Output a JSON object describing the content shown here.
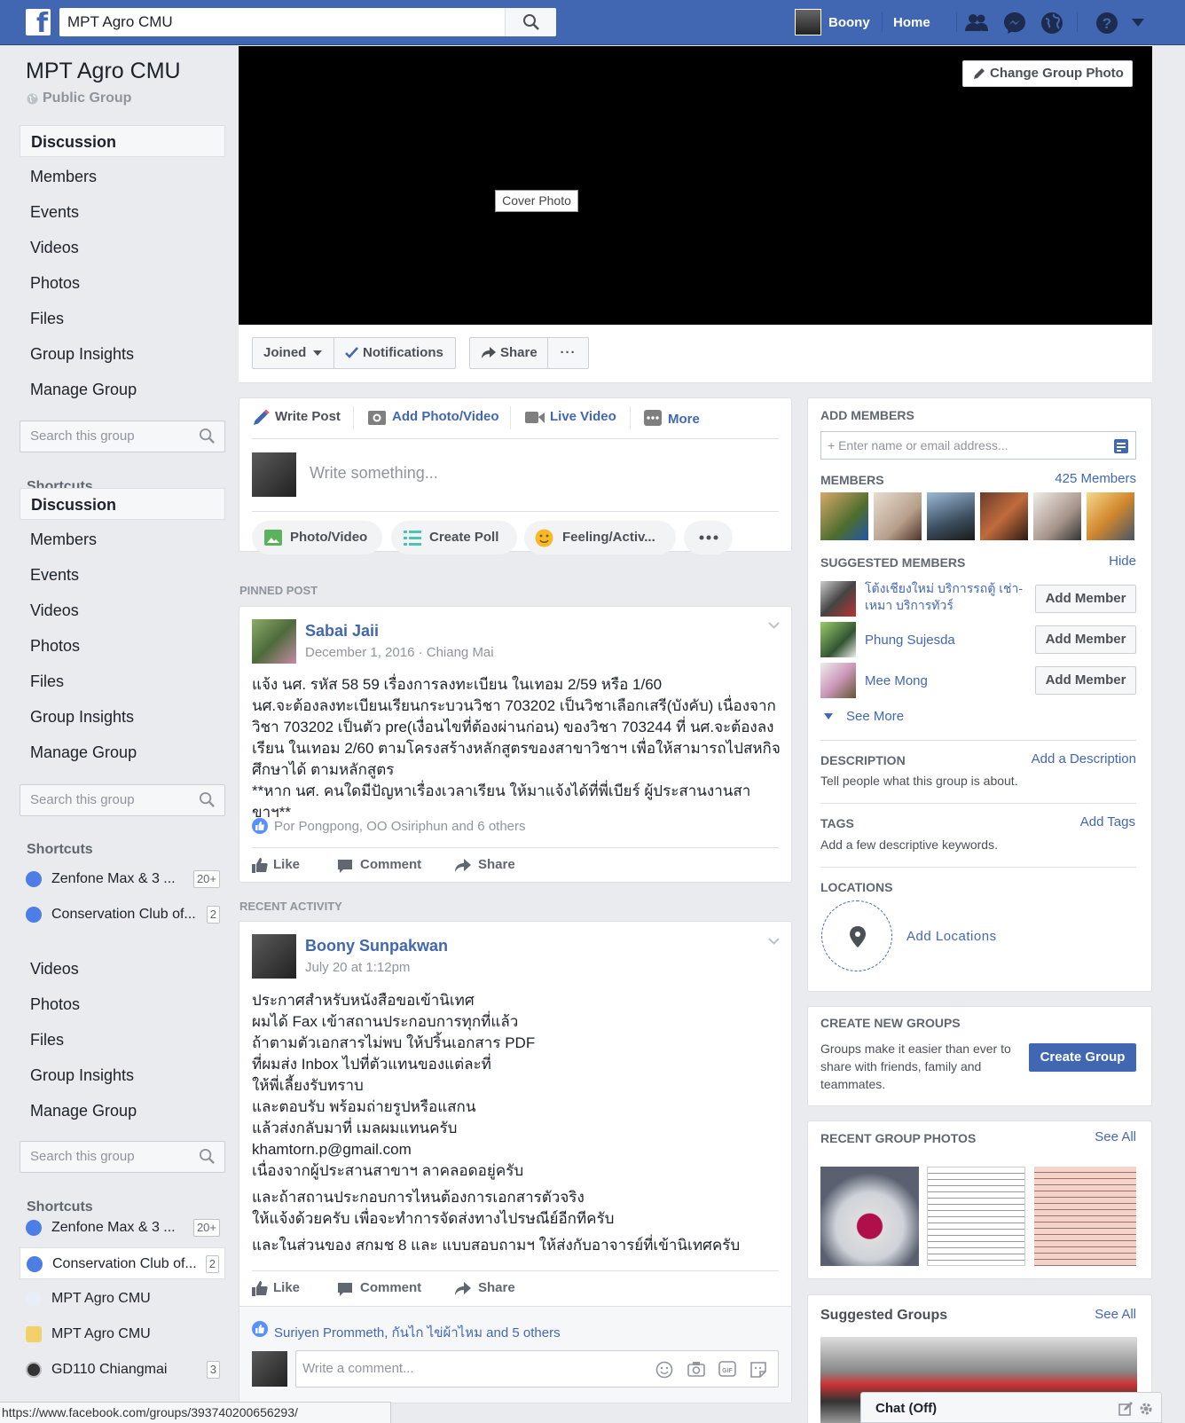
{
  "topbar": {
    "search_value": "MPT Agro CMU",
    "user_name": "Boony",
    "home_label": "Home"
  },
  "group": {
    "name": "MPT Agro CMU",
    "privacy": "Public Group"
  },
  "sidebar": {
    "nav1": [
      "Discussion",
      "Members",
      "Events",
      "Videos",
      "Photos",
      "Files",
      "Group Insights",
      "Manage Group"
    ],
    "search_placeholder": "Search this group",
    "shortcuts_label": "Shortcuts",
    "nav2": [
      "Discussion",
      "Members",
      "Events",
      "Videos",
      "Photos",
      "Files",
      "Group Insights",
      "Manage Group"
    ],
    "shortcuts_a": [
      {
        "label": "Zenfone Max & 3 ...",
        "count": "20+"
      },
      {
        "label": "Conservation Club of...",
        "count": "2"
      }
    ],
    "nav3": [
      "Videos",
      "Photos",
      "Files",
      "Group Insights",
      "Manage Group"
    ],
    "shortcuts_b": [
      {
        "label": "Zenfone Max & 3 ...",
        "count": "20+"
      },
      {
        "label": "Conservation Club of...",
        "count": "2"
      },
      {
        "label": "MPT Agro CMU",
        "count": ""
      },
      {
        "label": "MPT Agro CMU",
        "count": ""
      },
      {
        "label": "GD110 Chiangmai",
        "count": "3"
      }
    ]
  },
  "cover": {
    "label": "Cover Photo",
    "change_button": "Change Group Photo"
  },
  "actions": {
    "joined": "Joined",
    "notifications": "Notifications",
    "share": "Share",
    "more": "···"
  },
  "composer": {
    "tabs": [
      "Write Post",
      "Add Photo/Video",
      "Live Video",
      "More"
    ],
    "placeholder": "Write something...",
    "pills": [
      "Photo/Video",
      "Create Poll",
      "Feeling/Activ..."
    ]
  },
  "pinned": {
    "section_label": "PINNED POST",
    "author": "Sabai Jaii",
    "meta": "December 1, 2016 · Chiang Mai",
    "lines": [
      "แจ้ง นศ. รหัส 58 59 เรื่องการลงทะเบียน ในเทอม 2/59 หรือ 1/60",
      "นศ.จะต้องลงทะเบียนเรียนกระบวนวิชา 703202 เป็นวิชาเลือกเสรี(บังคับ) เนื่องจาก",
      "วิชา 703202 เป็นตัว pre(เงื่อนไขที่ต้องผ่านก่อน) ของวิชา 703244 ที่ นศ.จะต้องลง",
      "เรียน ในเทอม 2/60 ตามโครงสร้างหลักสูตรของสาขาวิชาฯ เพื่อให้สามารถไปสหกิจ",
      "ศึกษาได้ ตามหลักสูตร",
      "**หาก นศ. คนใดมีปัญหาเรื่องเวลาเรียน ให้มาแจ้งได้ที่พี่เบียร์ ผู้ประสานงานสาขาฯ**"
    ],
    "likes": "Por Pongpong, OO Osiriphun and 6 others"
  },
  "post_actions": [
    "Like",
    "Comment",
    "Share"
  ],
  "recent": {
    "section_label": "RECENT ACTIVITY",
    "author": "Boony Sunpakwan",
    "meta": "July 20 at 1:12pm",
    "lines_a": [
      "ประกาศสำหรับหนังสือขอเข้านิเทศ",
      "ผมได้ Fax เข้าสถานประกอบการทุกที่แล้ว",
      "ถ้าตามตัวเอกสารไม่พบ ให้ปริ้นเอกสาร PDF",
      "ที่ผมส่ง Inbox ไปที่ตัวแทนของแต่ละที่",
      "ให้พี่เลี้ยงรับทราบ",
      "และตอบรับ พร้อมถ่ายรูปหรือแสกน",
      "แล้วส่งกลับมาที่ เมลผมแทนครับ",
      "khamtorn.p@gmail.com",
      "เนื่องจากผู้ประสานสาขาฯ ลาคลอดอยู่ครับ"
    ],
    "lines_b": [
      "และถ้าสถานประกอบการไหนต้องการเอกสารตัวจริง",
      "ให้แจ้งด้วยครับ เพื่อจะทำการจัดส่งทางไปรษณีย์อีกทีครับ"
    ],
    "line_c": "และในส่วนของ สกมช 8 และ แบบสอบถามฯ ให้ส่งกับอาจารย์ที่เข้านิเทศครับ",
    "likes": "Suriyen Prommeth, กันไก ไข่ผ้าไหม and 5 others",
    "comment_placeholder": "Write a comment..."
  },
  "right": {
    "add_members_label": "ADD MEMBERS",
    "add_members_placeholder": "+ Enter name or email address...",
    "members_label": "MEMBERS",
    "members_count": "425 Members",
    "suggested_label": "SUGGESTED MEMBERS",
    "hide": "Hide",
    "suggested": [
      {
        "name": "โต้งเชียงใหม่ บริการรถตู้ เช่า-เหมา บริการทัวร์",
        "button": "Add Member"
      },
      {
        "name": "Phung Sujesda",
        "button": "Add Member"
      },
      {
        "name": "Mee Mong",
        "button": "Add Member"
      }
    ],
    "see_more": "See More",
    "description_label": "DESCRIPTION",
    "add_description": "Add a Description",
    "description_text": "Tell people what this group is about.",
    "tags_label": "TAGS",
    "add_tags": "Add Tags",
    "tags_text": "Add a few descriptive keywords.",
    "locations_label": "LOCATIONS",
    "add_locations": "Add Locations",
    "create_label": "CREATE NEW GROUPS",
    "create_text": "Groups make it easier than ever to share with friends, family and teammates.",
    "create_button": "Create Group",
    "photos_label": "RECENT GROUP PHOTOS",
    "see_all": "See All",
    "suggested_groups_label": "Suggested Groups",
    "see_all_2": "See All"
  },
  "chat": {
    "label": "Chat (Off)"
  },
  "status_url": "https://www.facebook.com/groups/393740200656293/",
  "colors": {
    "brand": "#4267b2",
    "background": "#e9ebee",
    "button_primary": "#4267b2"
  }
}
